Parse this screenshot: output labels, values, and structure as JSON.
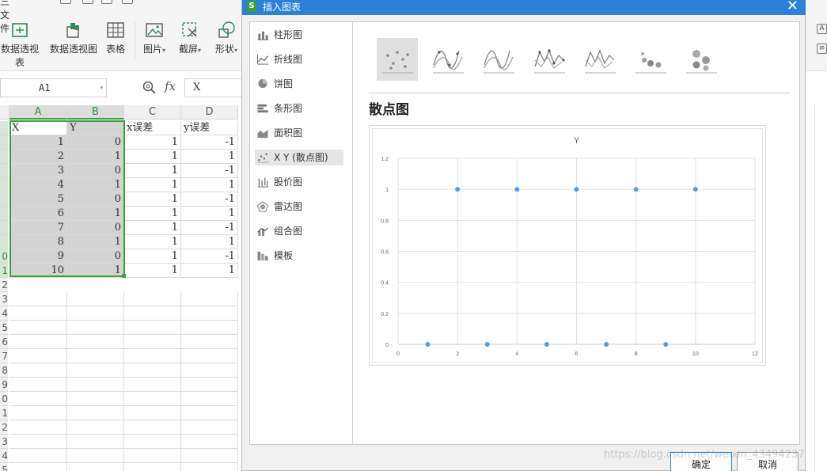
{
  "ribbon": {
    "menu_label": "三 文件",
    "buttons": [
      {
        "label": "数据透视表",
        "icon": "pivot-table-icon"
      },
      {
        "label": "数据透视图",
        "icon": "pivot-chart-icon"
      },
      {
        "label": "表格",
        "icon": "table-icon"
      },
      {
        "label": "图片",
        "icon": "picture-icon"
      },
      {
        "label": "截屏",
        "icon": "screenshot-icon"
      },
      {
        "label": "形状",
        "icon": "shapes-icon"
      }
    ]
  },
  "formula_bar": {
    "name_box": "A1",
    "fx_label": "fx",
    "formula": "X"
  },
  "sheet": {
    "columns": [
      "A",
      "B",
      "C",
      "D"
    ],
    "header_row": [
      "X",
      "Y",
      "x误差",
      "y误差"
    ],
    "rows": [
      [
        "1",
        "0",
        "1",
        "-1"
      ],
      [
        "2",
        "1",
        "1",
        "1"
      ],
      [
        "3",
        "0",
        "1",
        "-1"
      ],
      [
        "4",
        "1",
        "1",
        "1"
      ],
      [
        "5",
        "0",
        "1",
        "-1"
      ],
      [
        "6",
        "1",
        "1",
        "1"
      ],
      [
        "7",
        "0",
        "1",
        "-1"
      ],
      [
        "8",
        "1",
        "1",
        "1"
      ],
      [
        "9",
        "0",
        "1",
        "-1"
      ],
      [
        "10",
        "1",
        "1",
        "1"
      ]
    ],
    "row_numbers": [
      "",
      "",
      "",
      "",
      "",
      "",
      "",
      "",
      "",
      "0",
      "1",
      "2",
      "3",
      "4",
      "5",
      "6",
      "7",
      "8",
      "9",
      "0",
      "1",
      "2",
      "3",
      "4",
      "5"
    ]
  },
  "dialog": {
    "title": "插入图表",
    "app_badge": "S",
    "close_glyph": "✕",
    "categories": [
      {
        "label": "柱形图",
        "icon": "column-chart-icon"
      },
      {
        "label": "折线图",
        "icon": "line-chart-icon"
      },
      {
        "label": "饼图",
        "icon": "pie-chart-icon"
      },
      {
        "label": "条形图",
        "icon": "bar-chart-icon"
      },
      {
        "label": "面积图",
        "icon": "area-chart-icon"
      },
      {
        "label": "X Y (散点图)",
        "icon": "scatter-chart-icon"
      },
      {
        "label": "股价图",
        "icon": "stock-chart-icon"
      },
      {
        "label": "雷达图",
        "icon": "radar-chart-icon"
      },
      {
        "label": "组合图",
        "icon": "combo-chart-icon"
      },
      {
        "label": "模板",
        "icon": "template-icon"
      }
    ],
    "active_category": 5,
    "subtypes": [
      "scatter",
      "smooth-lines-markers",
      "smooth-lines",
      "straight-lines-markers",
      "straight-lines",
      "bubble",
      "3d-bubble"
    ],
    "active_subtype": 0,
    "subtype_title": "散点图",
    "ok_label": "确定",
    "cancel_label": "取消",
    "accent": "#2d7fd8"
  },
  "chart_data": {
    "type": "scatter",
    "title": "Y",
    "x": [
      1,
      2,
      3,
      4,
      5,
      6,
      7,
      8,
      9,
      10
    ],
    "y": [
      0,
      1,
      0,
      1,
      0,
      1,
      0,
      1,
      0,
      1
    ],
    "xlim": [
      0,
      12
    ],
    "ylim": [
      0,
      1.2
    ],
    "x_ticks": [
      "0",
      "2",
      "4",
      "6",
      "8",
      "10",
      "12"
    ],
    "y_ticks": [
      "0",
      "0.2",
      "0.4",
      "0.6",
      "0.8",
      "1",
      "1.2"
    ],
    "grid": true,
    "marker_color": "#5b9bd5"
  },
  "watermark": "https://blog.csdn.net/weixin_43494237"
}
